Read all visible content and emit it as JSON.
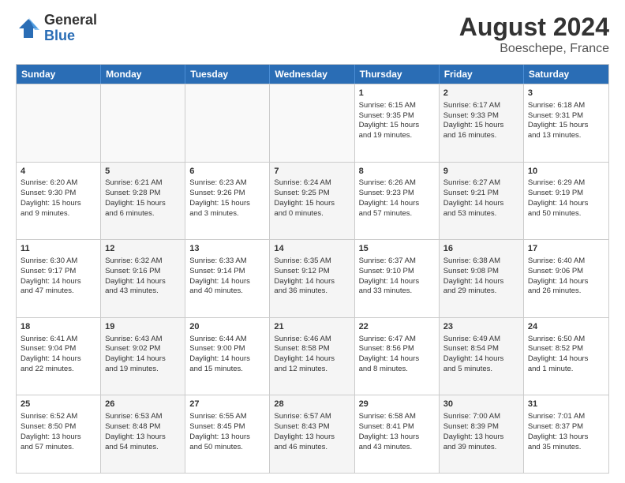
{
  "logo": {
    "general": "General",
    "blue": "Blue"
  },
  "header": {
    "month_year": "August 2024",
    "location": "Boeschepe, France"
  },
  "weekdays": [
    "Sunday",
    "Monday",
    "Tuesday",
    "Wednesday",
    "Thursday",
    "Friday",
    "Saturday"
  ],
  "rows": [
    [
      {
        "day": "",
        "info": "",
        "empty": true
      },
      {
        "day": "",
        "info": "",
        "empty": true
      },
      {
        "day": "",
        "info": "",
        "empty": true
      },
      {
        "day": "",
        "info": "",
        "empty": true
      },
      {
        "day": "1",
        "info": "Sunrise: 6:15 AM\nSunset: 9:35 PM\nDaylight: 15 hours\nand 19 minutes."
      },
      {
        "day": "2",
        "info": "Sunrise: 6:17 AM\nSunset: 9:33 PM\nDaylight: 15 hours\nand 16 minutes.",
        "alt": true
      },
      {
        "day": "3",
        "info": "Sunrise: 6:18 AM\nSunset: 9:31 PM\nDaylight: 15 hours\nand 13 minutes."
      }
    ],
    [
      {
        "day": "4",
        "info": "Sunrise: 6:20 AM\nSunset: 9:30 PM\nDaylight: 15 hours\nand 9 minutes."
      },
      {
        "day": "5",
        "info": "Sunrise: 6:21 AM\nSunset: 9:28 PM\nDaylight: 15 hours\nand 6 minutes.",
        "alt": true
      },
      {
        "day": "6",
        "info": "Sunrise: 6:23 AM\nSunset: 9:26 PM\nDaylight: 15 hours\nand 3 minutes."
      },
      {
        "day": "7",
        "info": "Sunrise: 6:24 AM\nSunset: 9:25 PM\nDaylight: 15 hours\nand 0 minutes.",
        "alt": true
      },
      {
        "day": "8",
        "info": "Sunrise: 6:26 AM\nSunset: 9:23 PM\nDaylight: 14 hours\nand 57 minutes."
      },
      {
        "day": "9",
        "info": "Sunrise: 6:27 AM\nSunset: 9:21 PM\nDaylight: 14 hours\nand 53 minutes.",
        "alt": true
      },
      {
        "day": "10",
        "info": "Sunrise: 6:29 AM\nSunset: 9:19 PM\nDaylight: 14 hours\nand 50 minutes."
      }
    ],
    [
      {
        "day": "11",
        "info": "Sunrise: 6:30 AM\nSunset: 9:17 PM\nDaylight: 14 hours\nand 47 minutes."
      },
      {
        "day": "12",
        "info": "Sunrise: 6:32 AM\nSunset: 9:16 PM\nDaylight: 14 hours\nand 43 minutes.",
        "alt": true
      },
      {
        "day": "13",
        "info": "Sunrise: 6:33 AM\nSunset: 9:14 PM\nDaylight: 14 hours\nand 40 minutes."
      },
      {
        "day": "14",
        "info": "Sunrise: 6:35 AM\nSunset: 9:12 PM\nDaylight: 14 hours\nand 36 minutes.",
        "alt": true
      },
      {
        "day": "15",
        "info": "Sunrise: 6:37 AM\nSunset: 9:10 PM\nDaylight: 14 hours\nand 33 minutes."
      },
      {
        "day": "16",
        "info": "Sunrise: 6:38 AM\nSunset: 9:08 PM\nDaylight: 14 hours\nand 29 minutes.",
        "alt": true
      },
      {
        "day": "17",
        "info": "Sunrise: 6:40 AM\nSunset: 9:06 PM\nDaylight: 14 hours\nand 26 minutes."
      }
    ],
    [
      {
        "day": "18",
        "info": "Sunrise: 6:41 AM\nSunset: 9:04 PM\nDaylight: 14 hours\nand 22 minutes."
      },
      {
        "day": "19",
        "info": "Sunrise: 6:43 AM\nSunset: 9:02 PM\nDaylight: 14 hours\nand 19 minutes.",
        "alt": true
      },
      {
        "day": "20",
        "info": "Sunrise: 6:44 AM\nSunset: 9:00 PM\nDaylight: 14 hours\nand 15 minutes."
      },
      {
        "day": "21",
        "info": "Sunrise: 6:46 AM\nSunset: 8:58 PM\nDaylight: 14 hours\nand 12 minutes.",
        "alt": true
      },
      {
        "day": "22",
        "info": "Sunrise: 6:47 AM\nSunset: 8:56 PM\nDaylight: 14 hours\nand 8 minutes."
      },
      {
        "day": "23",
        "info": "Sunrise: 6:49 AM\nSunset: 8:54 PM\nDaylight: 14 hours\nand 5 minutes.",
        "alt": true
      },
      {
        "day": "24",
        "info": "Sunrise: 6:50 AM\nSunset: 8:52 PM\nDaylight: 14 hours\nand 1 minute."
      }
    ],
    [
      {
        "day": "25",
        "info": "Sunrise: 6:52 AM\nSunset: 8:50 PM\nDaylight: 13 hours\nand 57 minutes."
      },
      {
        "day": "26",
        "info": "Sunrise: 6:53 AM\nSunset: 8:48 PM\nDaylight: 13 hours\nand 54 minutes.",
        "alt": true
      },
      {
        "day": "27",
        "info": "Sunrise: 6:55 AM\nSunset: 8:45 PM\nDaylight: 13 hours\nand 50 minutes."
      },
      {
        "day": "28",
        "info": "Sunrise: 6:57 AM\nSunset: 8:43 PM\nDaylight: 13 hours\nand 46 minutes.",
        "alt": true
      },
      {
        "day": "29",
        "info": "Sunrise: 6:58 AM\nSunset: 8:41 PM\nDaylight: 13 hours\nand 43 minutes."
      },
      {
        "day": "30",
        "info": "Sunrise: 7:00 AM\nSunset: 8:39 PM\nDaylight: 13 hours\nand 39 minutes.",
        "alt": true
      },
      {
        "day": "31",
        "info": "Sunrise: 7:01 AM\nSunset: 8:37 PM\nDaylight: 13 hours\nand 35 minutes."
      }
    ]
  ]
}
